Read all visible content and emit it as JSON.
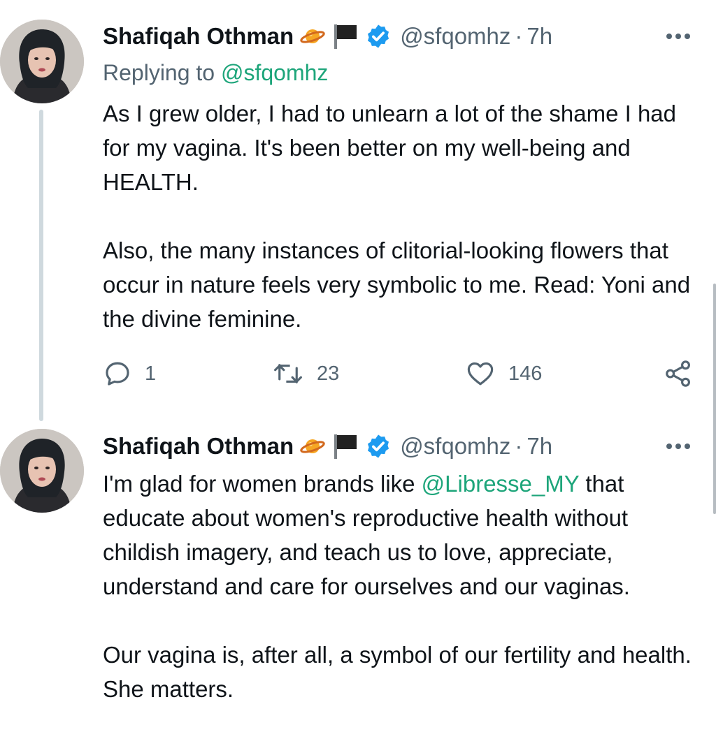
{
  "tweets": [
    {
      "author_name": "Shafiqah Othman",
      "handle": "@sfqomhz",
      "separator": "·",
      "time": "7h",
      "replying_to_prefix": "Replying to ",
      "replying_to_handle": "@sfqomhz",
      "body_text": "As I grew older, I had to unlearn a lot of the shame I had for my vagina. It's been better on my well-being and HEALTH.\n\nAlso, the many instances of clitorial-looking flowers that occur in nature feels very symbolic to me. Read: Yoni and the divine feminine.",
      "counts": {
        "replies": "1",
        "retweets": "23",
        "likes": "146"
      },
      "badges": [
        "planet-icon",
        "black-flag-icon",
        "verified-icon"
      ]
    },
    {
      "author_name": "Shafiqah Othman",
      "handle": "@sfqomhz",
      "separator": "·",
      "time": "7h",
      "body_before_mention": "I'm glad for women brands like ",
      "body_mention": "@Libresse_MY",
      "body_after_mention": " that educate about women's reproductive health without childish imagery, and teach us to love, appreciate, understand and care for ourselves and our vaginas.\n\nOur vagina is, after all, a symbol of our fertility and health. She matters.",
      "badges": [
        "planet-icon",
        "black-flag-icon",
        "verified-icon"
      ]
    }
  ],
  "colors": {
    "mention": "#1da57a",
    "verified": "#1d9bf0",
    "secondary_text": "#536471",
    "thread_line": "#cfd9de"
  }
}
